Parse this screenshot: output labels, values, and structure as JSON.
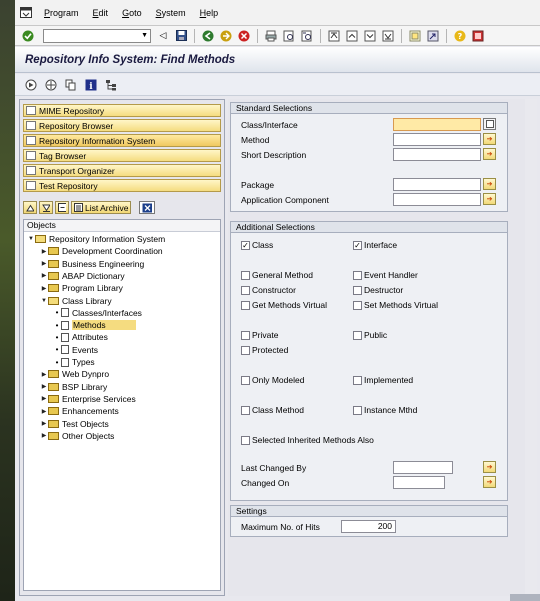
{
  "menu": {
    "items": [
      "Program",
      "Edit",
      "Goto",
      "System",
      "Help"
    ],
    "underline": [
      "P",
      "E",
      "G",
      "S",
      "H"
    ]
  },
  "toolbar": {
    "command_field": ""
  },
  "title": "Repository Info System: Find Methods",
  "nav_buttons": [
    {
      "label": "MIME Repository"
    },
    {
      "label": "Repository Browser"
    },
    {
      "label": "Repository Information System"
    },
    {
      "label": "Tag Browser"
    },
    {
      "label": "Transport Organizer"
    },
    {
      "label": "Test Repository"
    }
  ],
  "list_archive": "List Archive",
  "objects_header": "Objects",
  "tree": [
    {
      "label": "Repository Information System",
      "kind": "folder-open",
      "level": 0
    },
    {
      "label": "Development Coordination",
      "kind": "folder",
      "level": 1
    },
    {
      "label": "Business Engineering",
      "kind": "folder",
      "level": 1
    },
    {
      "label": "ABAP Dictionary",
      "kind": "folder",
      "level": 1
    },
    {
      "label": "Program Library",
      "kind": "folder",
      "level": 1
    },
    {
      "label": "Class Library",
      "kind": "folder-open",
      "level": 1
    },
    {
      "label": "Classes/Interfaces",
      "kind": "leaf",
      "level": 2
    },
    {
      "label": "Methods",
      "kind": "leaf",
      "level": 2,
      "selected": true
    },
    {
      "label": "Attributes",
      "kind": "leaf",
      "level": 2
    },
    {
      "label": "Events",
      "kind": "leaf",
      "level": 2
    },
    {
      "label": "Types",
      "kind": "leaf",
      "level": 2
    },
    {
      "label": "Web Dynpro",
      "kind": "folder",
      "level": 1
    },
    {
      "label": "BSP Library",
      "kind": "folder",
      "level": 1
    },
    {
      "label": "Enterprise Services",
      "kind": "folder",
      "level": 1
    },
    {
      "label": "Enhancements",
      "kind": "folder",
      "level": 1
    },
    {
      "label": "Test Objects",
      "kind": "folder",
      "level": 1
    },
    {
      "label": "Other Objects",
      "kind": "folder",
      "level": 1
    }
  ],
  "standard": {
    "header": "Standard Selections",
    "class_interface": {
      "label": "Class/Interface",
      "value": ""
    },
    "method": {
      "label": "Method",
      "value": ""
    },
    "short_description": {
      "label": "Short Description",
      "value": ""
    },
    "package": {
      "label": "Package",
      "value": ""
    },
    "application_component": {
      "label": "Application Component",
      "value": ""
    }
  },
  "additional": {
    "header": "Additional Selections",
    "checks": [
      {
        "label": "Class",
        "checked": true
      },
      {
        "label": "Interface",
        "checked": true
      },
      {
        "label": "General Method",
        "checked": false
      },
      {
        "label": "Event Handler",
        "checked": false
      },
      {
        "label": "Constructor",
        "checked": false
      },
      {
        "label": "Destructor",
        "checked": false
      },
      {
        "label": "Get Methods Virtual",
        "checked": false
      },
      {
        "label": "Set Methods Virtual",
        "checked": false
      },
      {
        "label": "Private",
        "checked": false
      },
      {
        "label": "Public",
        "checked": false
      },
      {
        "label": "Protected",
        "checked": false
      },
      {
        "label": "Only Modeled",
        "checked": false
      },
      {
        "label": "Implemented",
        "checked": false
      },
      {
        "label": "Class Method",
        "checked": false
      },
      {
        "label": "Instance Mthd",
        "checked": false
      },
      {
        "label": "Selected Inherited Methods Also",
        "checked": false
      }
    ],
    "last_changed_by": {
      "label": "Last Changed By",
      "value": ""
    },
    "changed_on": {
      "label": "Changed On",
      "value": ""
    }
  },
  "settings": {
    "header": "Settings",
    "max_hits": {
      "label": "Maximum No. of Hits",
      "value": "200"
    }
  },
  "colors": {
    "nav_button": "#f5dc80",
    "selected_tree": "#f5dc80",
    "focus_field": "#ffeaa6"
  }
}
